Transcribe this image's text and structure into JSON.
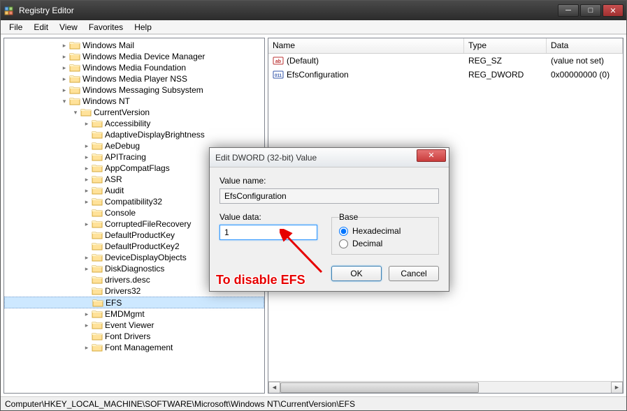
{
  "title": "Registry Editor",
  "menu": [
    "File",
    "Edit",
    "View",
    "Favorites",
    "Help"
  ],
  "winbtns": {
    "min": "─",
    "max": "□",
    "close": "✕"
  },
  "columns": {
    "name": "Name",
    "type": "Type",
    "data": "Data"
  },
  "values": [
    {
      "icon": "str",
      "name": "(Default)",
      "type": "REG_SZ",
      "data": "(value not set)"
    },
    {
      "icon": "dw",
      "name": "EfsConfiguration",
      "type": "REG_DWORD",
      "data": "0x00000000 (0)"
    }
  ],
  "tree": [
    {
      "d": 5,
      "e": "r",
      "t": "Windows Mail"
    },
    {
      "d": 5,
      "e": "r",
      "t": "Windows Media Device Manager"
    },
    {
      "d": 5,
      "e": "r",
      "t": "Windows Media Foundation"
    },
    {
      "d": 5,
      "e": "r",
      "t": "Windows Media Player NSS"
    },
    {
      "d": 5,
      "e": "r",
      "t": "Windows Messaging Subsystem"
    },
    {
      "d": 5,
      "e": "d",
      "t": "Windows NT"
    },
    {
      "d": 6,
      "e": "d",
      "t": "CurrentVersion"
    },
    {
      "d": 7,
      "e": "r",
      "t": "Accessibility"
    },
    {
      "d": 7,
      "e": "",
      "t": "AdaptiveDisplayBrightness"
    },
    {
      "d": 7,
      "e": "r",
      "t": "AeDebug"
    },
    {
      "d": 7,
      "e": "r",
      "t": "APITracing"
    },
    {
      "d": 7,
      "e": "r",
      "t": "AppCompatFlags"
    },
    {
      "d": 7,
      "e": "r",
      "t": "ASR"
    },
    {
      "d": 7,
      "e": "r",
      "t": "Audit"
    },
    {
      "d": 7,
      "e": "r",
      "t": "Compatibility32"
    },
    {
      "d": 7,
      "e": "",
      "t": "Console"
    },
    {
      "d": 7,
      "e": "r",
      "t": "CorruptedFileRecovery"
    },
    {
      "d": 7,
      "e": "",
      "t": "DefaultProductKey"
    },
    {
      "d": 7,
      "e": "",
      "t": "DefaultProductKey2"
    },
    {
      "d": 7,
      "e": "r",
      "t": "DeviceDisplayObjects"
    },
    {
      "d": 7,
      "e": "r",
      "t": "DiskDiagnostics"
    },
    {
      "d": 7,
      "e": "",
      "t": "drivers.desc"
    },
    {
      "d": 7,
      "e": "",
      "t": "Drivers32"
    },
    {
      "d": 7,
      "e": "",
      "t": "EFS",
      "sel": true
    },
    {
      "d": 7,
      "e": "r",
      "t": "EMDMgmt"
    },
    {
      "d": 7,
      "e": "r",
      "t": "Event Viewer"
    },
    {
      "d": 7,
      "e": "",
      "t": "Font Drivers"
    },
    {
      "d": 7,
      "e": "r",
      "t": "Font Management"
    }
  ],
  "status": "Computer\\HKEY_LOCAL_MACHINE\\SOFTWARE\\Microsoft\\Windows NT\\CurrentVersion\\EFS",
  "dialog": {
    "title": "Edit DWORD (32-bit) Value",
    "valuename_lbl": "Value name:",
    "valuename": "EfsConfiguration",
    "valuedata_lbl": "Value data:",
    "valuedata": "1",
    "base_lbl": "Base",
    "hex": "Hexadecimal",
    "dec": "Decimal",
    "ok": "OK",
    "cancel": "Cancel",
    "close": "✕"
  },
  "annotation": "To disable EFS"
}
